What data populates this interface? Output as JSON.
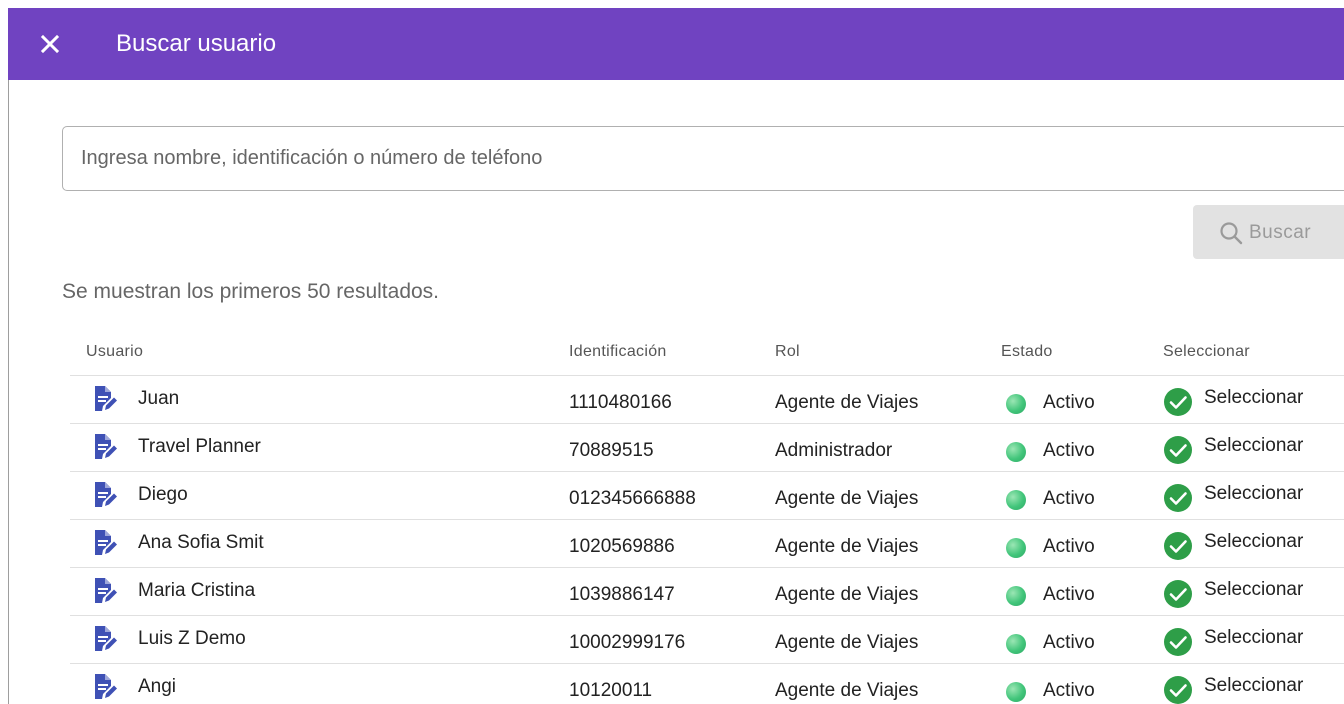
{
  "dialog": {
    "title": "Buscar usuario"
  },
  "search": {
    "placeholder": "Ingresa nombre, identificación o número de teléfono",
    "value": "",
    "button_label": "Buscar"
  },
  "results_note": "Se muestran los primeros 50 resultados.",
  "table": {
    "headers": {
      "user": "Usuario",
      "id": "Identificación",
      "role": "Rol",
      "state": "Estado",
      "select": "Seleccionar"
    },
    "rows": [
      {
        "name": "Juan",
        "id": "1110480166",
        "role": "Agente de Viajes",
        "state": "Activo",
        "select": "Seleccionar"
      },
      {
        "name": "Travel Planner",
        "id": "70889515",
        "role": "Administrador",
        "state": "Activo",
        "select": "Seleccionar"
      },
      {
        "name": "Diego",
        "id": "012345666888",
        "role": "Agente de Viajes",
        "state": "Activo",
        "select": "Seleccionar"
      },
      {
        "name": "Ana Sofia Smit",
        "id": "1020569886",
        "role": "Agente de Viajes",
        "state": "Activo",
        "select": "Seleccionar"
      },
      {
        "name": "Maria Cristina",
        "id": "1039886147",
        "role": "Agente de Viajes",
        "state": "Activo",
        "select": "Seleccionar"
      },
      {
        "name": "Luis Z Demo",
        "id": "10002999176",
        "role": "Agente de Viajes",
        "state": "Activo",
        "select": "Seleccionar"
      },
      {
        "name": "Angi",
        "id": "10120011",
        "role": "Agente de Viajes",
        "state": "Activo",
        "select": "Seleccionar"
      }
    ]
  },
  "icons": {
    "close": "close-icon",
    "search": "search-icon",
    "edit": "edit-document-icon",
    "status": "status-dot-icon",
    "select": "check-circle-icon"
  },
  "colors": {
    "header": "#7043c1",
    "edit_icon": "#3f51b5",
    "active_dot": "#41c57a",
    "select_check": "#2e9e48",
    "search_button_bg": "#e2e2e2"
  }
}
